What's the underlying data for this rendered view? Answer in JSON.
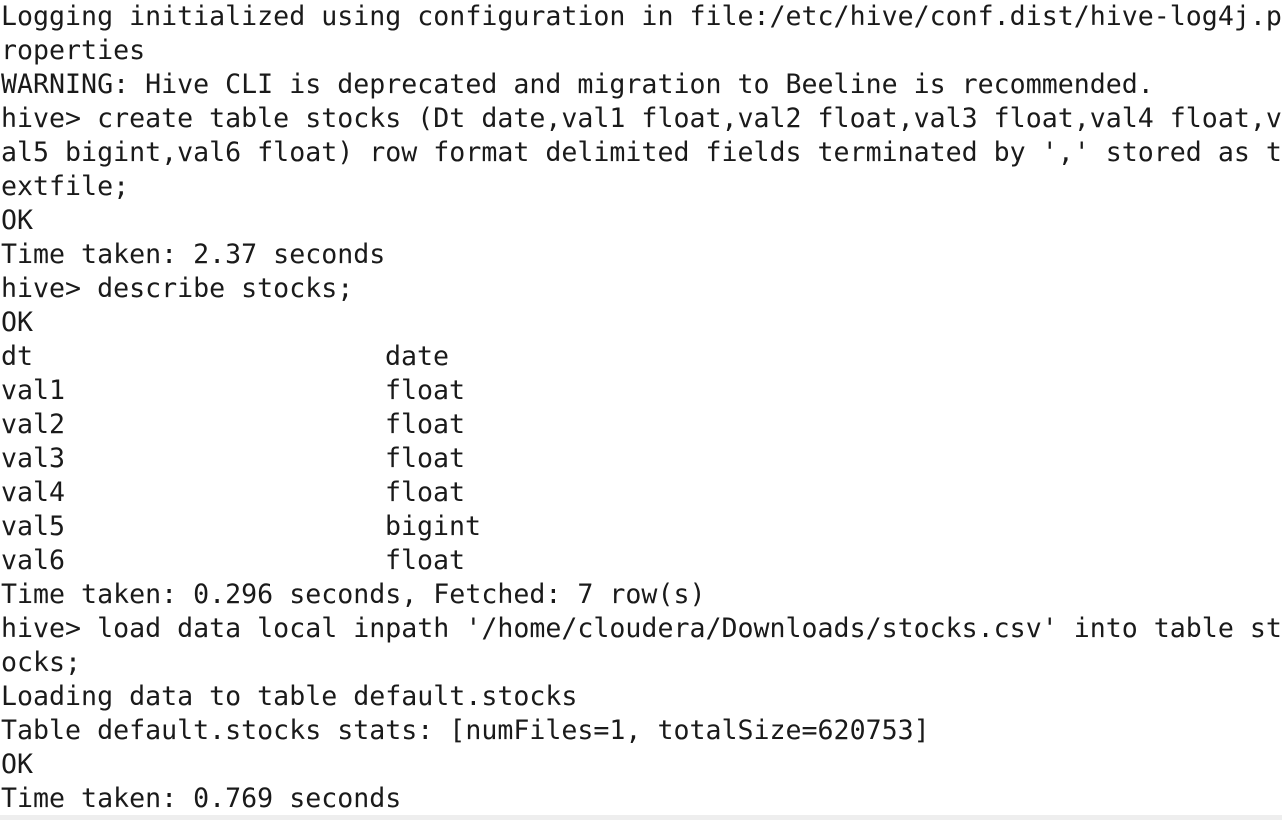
{
  "terminal": {
    "log_line_1": "Logging initialized using configuration in file:/etc/hive/conf.dist/hive-log4j.p",
    "log_line_2": "roperties",
    "warning": "WARNING: Hive CLI is deprecated and migration to Beeline is recommended.",
    "create_cmd_1": "hive> create table stocks (Dt date,val1 float,val2 float,val3 float,val4 float,v",
    "create_cmd_2": "al5 bigint,val6 float) row format delimited fields terminated by ',' stored as t",
    "create_cmd_3": "extfile;",
    "ok_1": "OK",
    "time_1": "Time taken: 2.37 seconds",
    "describe_cmd": "hive> describe stocks;",
    "ok_2": "OK",
    "describe_rows": [
      {
        "name": "dt",
        "type": "date"
      },
      {
        "name": "val1",
        "type": "float"
      },
      {
        "name": "val2",
        "type": "float"
      },
      {
        "name": "val3",
        "type": "float"
      },
      {
        "name": "val4",
        "type": "float"
      },
      {
        "name": "val5",
        "type": "bigint"
      },
      {
        "name": "val6",
        "type": "float"
      }
    ],
    "time_2": "Time taken: 0.296 seconds, Fetched: 7 row(s)",
    "load_cmd_1": "hive> load data local inpath '/home/cloudera/Downloads/stocks.csv' into table st",
    "load_cmd_2": "ocks;",
    "loading": "Loading data to table default.stocks",
    "stats": "Table default.stocks stats: [numFiles=1, totalSize=620753]",
    "ok_3": "OK",
    "time_3": "Time taken: 0.769 seconds"
  }
}
